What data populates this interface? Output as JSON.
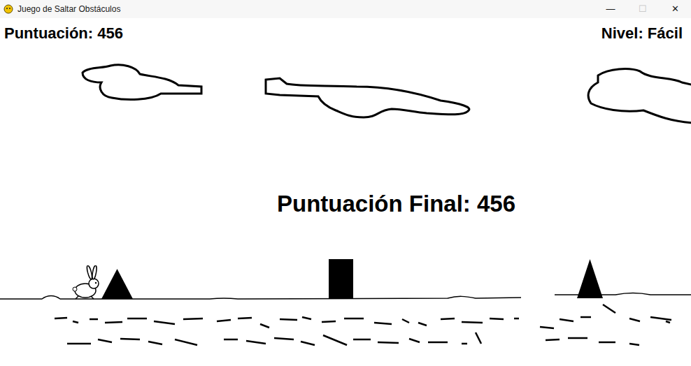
{
  "window": {
    "title": "Juego de Saltar Obstáculos",
    "controls": [
      {
        "label": "—",
        "disabled": false
      },
      {
        "label": "☐",
        "disabled": true
      },
      {
        "label": "✕",
        "disabled": false
      }
    ]
  },
  "hud": {
    "score": "Puntuación: 456",
    "level": "Nivel: Fácil"
  },
  "game_over": {
    "final_score": "Puntuación Final: 456"
  },
  "obstacles": [
    {
      "kind": "triangle"
    },
    {
      "kind": "rectangle"
    },
    {
      "kind": "triangle"
    }
  ]
}
